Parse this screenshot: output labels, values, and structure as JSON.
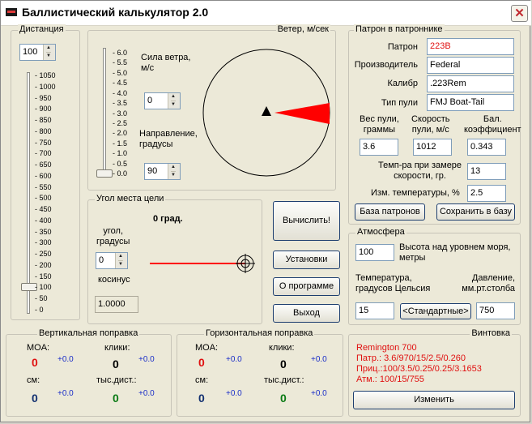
{
  "window": {
    "title": "Баллистический калькулятор 2.0"
  },
  "distance": {
    "title": "Дистанция",
    "value": "100",
    "ticks": [
      "1050",
      "1000",
      "950",
      "900",
      "850",
      "800",
      "750",
      "700",
      "650",
      "600",
      "550",
      "500",
      "450",
      "400",
      "350",
      "300",
      "250",
      "200",
      "150",
      "100",
      "50",
      "0"
    ],
    "slider_level": 100,
    "max": 1050
  },
  "wind": {
    "title": "Ветер, м/сек",
    "strength_label": "Сила ветра,\nм/с",
    "strength_value": "0",
    "direction_label": "Направление,\nградусы",
    "direction_value": "90",
    "ticks": [
      "6.0",
      "5.5",
      "5.0",
      "4.5",
      "4.0",
      "3.5",
      "3.0",
      "2.5",
      "2.0",
      "1.5",
      "1.0",
      "0.5",
      "0.0"
    ],
    "slider_level": 0
  },
  "angle": {
    "title": "Угол места цели",
    "display": "0 град.",
    "angle_label": "угол,\nградусы",
    "angle_value": "0",
    "cos_label": "косинус",
    "cos_value": "1.0000"
  },
  "buttons": {
    "calculate": "Вычислить!",
    "settings": "Установки",
    "about": "О программе",
    "exit": "Выход"
  },
  "cartridge": {
    "title": "Патрон в патроннике",
    "fields": [
      {
        "label": "Патрон",
        "value": "223B"
      },
      {
        "label": "Производитель",
        "value": "Federal"
      },
      {
        "label": "Калибр",
        "value": ".223Rem"
      },
      {
        "label": "Тип пули",
        "value": "FMJ Boat-Tail"
      }
    ],
    "weight_label": "Вес пули,\nграммы",
    "weight_value": "3.6",
    "speed_label": "Скорость\nпули, м/с",
    "speed_value": "1012",
    "bc_label": "Бал.\nкоэффициент",
    "bc_value": "0.343",
    "temp_label": "Темп-ра при замере\nскорости, гр.",
    "temp_value": "13",
    "tchange_label": "Изм. температуры, %",
    "tchange_value": "2.5",
    "db_button": "База патронов",
    "save_button": "Сохранить в базу"
  },
  "atmosphere": {
    "title": "Атмосфера",
    "altitude_label": "Высота над уровнем моря,\nметры",
    "altitude_value": "100",
    "temp_label": "Температура,\nградусов Цельсия",
    "temp_value": "15",
    "std_button": "<Стандартные>",
    "pressure_label": "Давление,\nмм.рт.столба",
    "pressure_value": "750"
  },
  "vertical": {
    "title": "Вертикальная поправка",
    "moa_label": "MOA:",
    "moa_value": "0",
    "moa_delta": "+0.0",
    "clicks_label": "клики:",
    "clicks_value": "0",
    "clicks_delta": "+0.0",
    "cm_label": "см:",
    "cm_value": "0",
    "cm_delta": "+0.0",
    "thou_label": "тыс.дист.:",
    "thou_value": "0",
    "thou_delta": "+0.0"
  },
  "horizontal": {
    "title": "Горизонтальная поправка",
    "moa_label": "MOA:",
    "moa_value": "0",
    "moa_delta": "+0.0",
    "clicks_label": "клики:",
    "clicks_value": "0",
    "clicks_delta": "+0.0",
    "cm_label": "см:",
    "cm_value": "0",
    "cm_delta": "+0.0",
    "thou_label": "тыс.дист.:",
    "thou_value": "0",
    "thou_delta": "+0.0"
  },
  "rifle": {
    "title": "Винтовка",
    "lines": [
      "Remington 700",
      "Патр.: 3.6/970/15/2.5/0.260",
      "Приц.:100/3.5/0.25/0.25/3.1653",
      "Атм.: 100/15/755"
    ],
    "change_button": "Изменить"
  },
  "colors": {
    "accent_red": "#e01010",
    "blue": "#1a2ec8",
    "green": "#0a7a14",
    "navy": "#123070"
  }
}
